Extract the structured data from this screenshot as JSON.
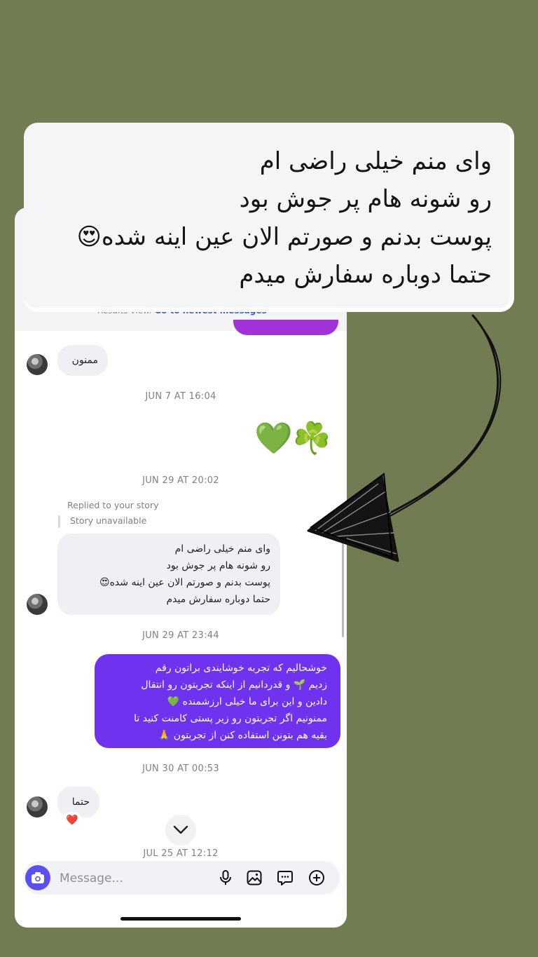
{
  "callout": {
    "lines": [
      "وای منم خیلی راضی ام",
      "رو شونه هام پر جوش بود",
      "پوست بدنم و صورتم الان عین اینه شده😍",
      "حتما دوباره سفارش میدم"
    ]
  },
  "results": {
    "text": "Results view.",
    "link": "Go to newest messages"
  },
  "messages": {
    "m1": "ممنون",
    "ts1": "JUN 7 AT 16:04",
    "emojis": "💚☘️",
    "ts2": "JUN 29 AT 20:02",
    "replied": "Replied to your story",
    "story_unavailable": "Story unavailable",
    "m2_lines": [
      "وای منم خیلی راضی ام",
      "رو شونه هام پر جوش بود",
      "پوست بدنم و صورتم الان عین اینه شده😍",
      "حتما دوباره سفارش میدم"
    ],
    "ts3": "JUN 29 AT 23:44",
    "m3_lines": [
      "خوشحالیم که تجربه خوشایندی براتون رقم",
      "زدیم 🌱 و قدردانیم از اینکه تجربتون رو انتقال",
      "دادین و این برای ما خیلی ارزشمنده 💚",
      "ممنونیم اگر تجربتون رو زیر پستی کامنت کنید تا",
      "بقیه هم بتونن استفاده کنن از تجربتون 🙏"
    ],
    "ts4": "JUN 30 AT 00:53",
    "m4": "حتما",
    "reaction": "❤️",
    "ts5": "JUL 25 AT 12:12"
  },
  "composer": {
    "placeholder": "Message..."
  },
  "icons": {
    "camera": "camera-icon",
    "mic": "microphone-icon",
    "gallery": "gallery-icon",
    "sticker": "sticker-icon",
    "plus": "plus-icon",
    "chevron": "chevron-down-icon"
  },
  "colors": {
    "background": "#717c53",
    "outgoing_bubble": "#6f33f0",
    "incoming_bubble": "#eff0f3",
    "camera_button": "#5a50f0"
  }
}
